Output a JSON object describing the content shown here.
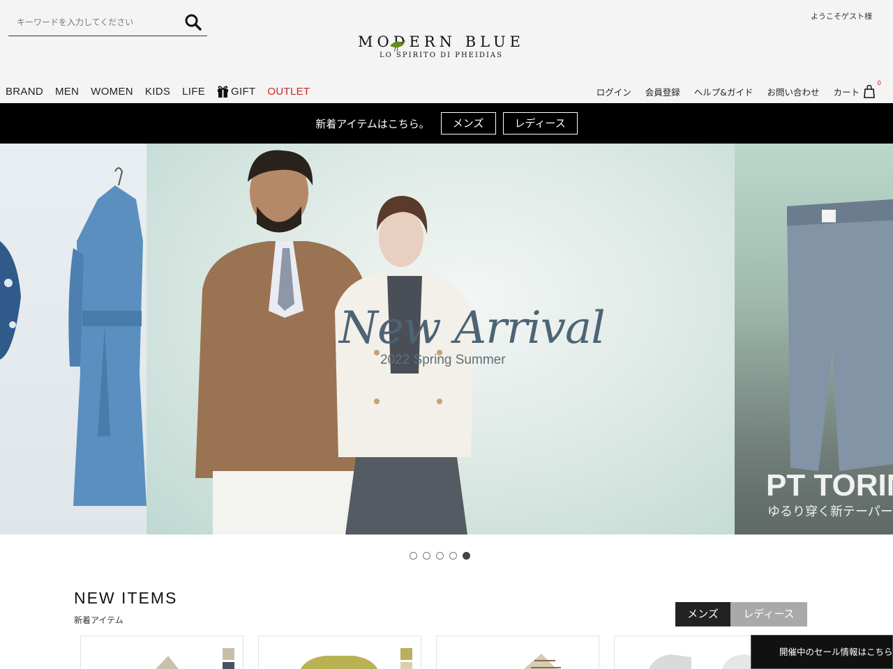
{
  "header": {
    "search_placeholder": "キーワードを入力してください",
    "welcome": "ようこそゲスト様",
    "logo_main": "MODERN BLUE",
    "logo_sub": "LO SPIRITO DI PHEIDIAS"
  },
  "main_nav": {
    "brand": "BRAND",
    "men": "MEN",
    "women": "WOMEN",
    "kids": "KIDS",
    "life": "LIFE",
    "gift": "GIFT",
    "outlet": "OUTLET"
  },
  "util_nav": {
    "login": "ログイン",
    "register": "会員登録",
    "help": "ヘルプ&ガイド",
    "contact": "お問い合わせ",
    "cart": "カート",
    "cart_count": "0"
  },
  "notice": {
    "text": "新着アイテムはこちら。",
    "men_button": "メンズ",
    "ladies_button": "レディース"
  },
  "hero": {
    "title": "New Arrival",
    "subtitle": "2022 Spring Summer",
    "right_title": "PT TORIN",
    "right_subtitle": "ゆるり穿く新テーパー",
    "slide_count": 5,
    "active_slide": 5
  },
  "new_items": {
    "title": "NEW ITEMS",
    "subtitle": "新着アイテム",
    "tab_men": "メンズ",
    "tab_ladies": "レディース"
  },
  "sale_popup": {
    "text": "開催中のセール情報はこちら"
  },
  "colors": {
    "accent_red": "#c62828",
    "dark": "#222222",
    "hero_text": "#4d6475"
  }
}
